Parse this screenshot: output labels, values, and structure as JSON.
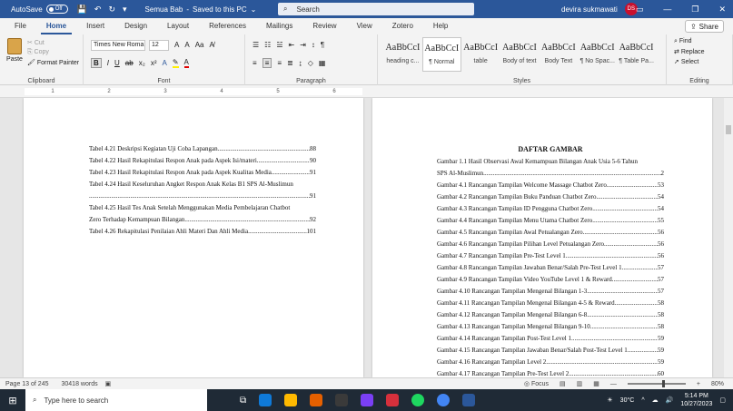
{
  "titlebar": {
    "autosave_label": "AutoSave",
    "autosave_state": "Off",
    "doc_title": "Semua Bab",
    "save_state": "Saved to this PC",
    "search_placeholder": "Search",
    "user_name": "devira sukmawati",
    "user_initials": "DS"
  },
  "tabs": [
    "File",
    "Home",
    "Insert",
    "Design",
    "Layout",
    "References",
    "Mailings",
    "Review",
    "View",
    "Zotero",
    "Help"
  ],
  "active_tab": "Home",
  "share_label": "Share",
  "ribbon": {
    "clipboard": {
      "paste": "Paste",
      "cut": "Cut",
      "copy": "Copy",
      "format_painter": "Format Painter",
      "label": "Clipboard"
    },
    "font": {
      "name": "Times New Roma",
      "size": "12",
      "label": "Font"
    },
    "paragraph": {
      "label": "Paragraph"
    },
    "styles": {
      "label": "Styles",
      "items": [
        {
          "sample": "AaBbCcI",
          "name": "heading c..."
        },
        {
          "sample": "AaBbCcI",
          "name": "¶ Normal"
        },
        {
          "sample": "AaBbCcI",
          "name": "table"
        },
        {
          "sample": "AaBbCcI",
          "name": "Body of text"
        },
        {
          "sample": "AaBbCcI",
          "name": "Body Text"
        },
        {
          "sample": "AaBbCcI",
          "name": "¶ No Spac..."
        },
        {
          "sample": "AaBbCcI",
          "name": "¶ Table Pa..."
        }
      ]
    },
    "editing": {
      "label": "Editing",
      "find": "Find",
      "replace": "Replace",
      "select": "Select"
    }
  },
  "ruler": {
    "labels": [
      "1",
      "2",
      "3",
      "4",
      "5",
      "6"
    ]
  },
  "left_page": {
    "entries": [
      {
        "text": "Tabel 4.21 Deskripsi Kegiatan Uji Coba Lapangan",
        "page": "88"
      },
      {
        "text": "Tabel 4.22 Hasil Rekapitulasi Respon Anak pada Aspek Isi/materi",
        "page": "90"
      },
      {
        "text": "Tabel 4.23 Hasil Rekapitulasi Respon Anak pada Aspek Kualitas Media",
        "page": "91"
      },
      {
        "text": "Tabel 4.24 Hasil Keseluruhan Angket Respon Anak Kelas B1 SPS Al-Muslimun",
        "page": ""
      },
      {
        "text": "",
        "page": "91"
      },
      {
        "text": "Tabel 4.25 Hasil Tes Anak Setelah Menggunakan Media Pembelajaran Chatbot",
        "page": ""
      },
      {
        "text": "Zero Terhadap Kemampuan Bilangan",
        "page": "92"
      },
      {
        "text": "Tabel 4.26 Rekapitulasi Penilaian Ahli Materi Dan Ahli Media",
        "page": "101"
      }
    ]
  },
  "right_page": {
    "heading": "DAFTAR GAMBAR",
    "entries": [
      {
        "text": "Gambar 1.1 Hasil Observasi Awal Kemampuan Bilangan Anak Usia 5-6 Tahun",
        "page": ""
      },
      {
        "text": "SPS Al-Muslimun",
        "page": "2"
      },
      {
        "text": "Gambar 4.1 Rancangan Tampilan Welcome Massage Chatbot Zero",
        "page": "53"
      },
      {
        "text": "Gambar 4.2 Rancangan Tampilan Buku Panduan Chatbot Zero",
        "page": "54"
      },
      {
        "text": "Gambar 4.3 Rancangan Tampilan ID Pengguna Chatbot Zero",
        "page": "54"
      },
      {
        "text": "Gambar 4.4 Rancangan Tampilan Menu Utama Chatbot Zero",
        "page": "55"
      },
      {
        "text": "Gambar 4.5 Rancangan Tampilan Awal Petualangan Zero",
        "page": "56"
      },
      {
        "text": "Gambar 4.6 Rancangan Tampilan Pilihan Level Petualangan Zero",
        "page": "56"
      },
      {
        "text": "Gambar 4.7 Rancangan Tampilan Pre-Test Level 1",
        "page": "56"
      },
      {
        "text": "Gambar 4.8 Rancangan Tampilan Jawaban Benar/Salah Pre-Test Level 1",
        "page": "57"
      },
      {
        "text": "Gambar 4.9 Rancangan Tampilan Video YouTube Level 1 & Reward",
        "page": "57"
      },
      {
        "text": "Gambar 4.10 Rancangan Tampilan Mengenal Bilangan 1-3",
        "page": "57"
      },
      {
        "text": "Gambar 4.11 Rancangan Tampilan Mengenal Bilangan 4-5 & Reward",
        "page": "58"
      },
      {
        "text": "Gambar 4.12 Rancangan Tampilan Mengenal Bilangan 6-8",
        "page": "58"
      },
      {
        "text": "Gambar 4.13 Rancangan Tampilan Mengenal Bilangan 9-10",
        "page": "58"
      },
      {
        "text": "Gambar 4.14 Rancangan Tampilan Post-Test Level 1",
        "page": "59"
      },
      {
        "text": "Gambar 4.15 Rancangan Tampilan Jawaban Benar/Salah Post-Test Level 1",
        "page": "59"
      },
      {
        "text": "Gambar 4.16 Rancangan Tampilan Level 2",
        "page": "59"
      },
      {
        "text": "Gambar 4.17 Rancangan Tampilan Pre-Test Level 2",
        "page": "60"
      }
    ]
  },
  "statusbar": {
    "page": "Page 13 of 245",
    "words": "30418 words",
    "focus": "Focus",
    "zoom": "80%",
    "zoom_level": 0.6
  },
  "taskbar": {
    "search_placeholder": "Type here to search",
    "temperature": "30°C",
    "time": "5:14 PM",
    "date": "10/27/2023"
  }
}
